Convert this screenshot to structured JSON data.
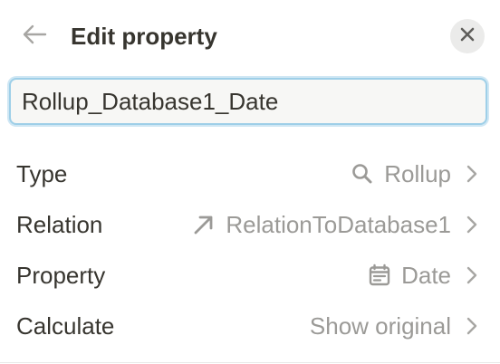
{
  "header": {
    "title": "Edit property",
    "back_icon": "arrow-left-icon",
    "close_icon": "close-icon"
  },
  "property_name": {
    "value": "Rollup_Database1_Date"
  },
  "rows": [
    {
      "label": "Type",
      "value": "Rollup",
      "icon": "magnifier-icon"
    },
    {
      "label": "Relation",
      "value": "RelationToDatabase1",
      "icon": "arrow-up-right-icon"
    },
    {
      "label": "Property",
      "value": "Date",
      "icon": "calendar-icon"
    },
    {
      "label": "Calculate",
      "value": "Show original",
      "icon": ""
    }
  ],
  "colors": {
    "text": "#37352f",
    "muted": "#9b9a97",
    "input_focus_border": "#9ecfe8",
    "input_bg": "#f7f7f5",
    "close_bg": "#ebebea"
  }
}
